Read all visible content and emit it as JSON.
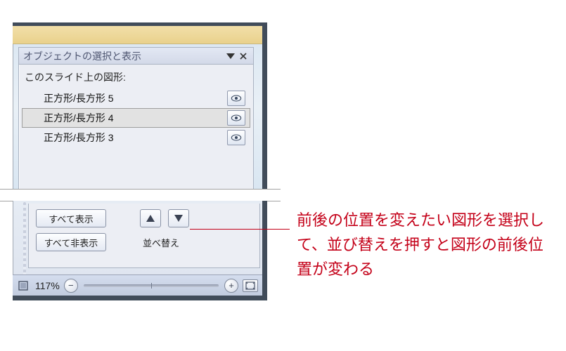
{
  "pane": {
    "title": "オブジェクトの選択と表示",
    "sub_label": "このスライド上の図形:"
  },
  "shapes": [
    {
      "label": "正方形/長方形 5",
      "selected": false
    },
    {
      "label": "正方形/長方形 4",
      "selected": true
    },
    {
      "label": "正方形/長方形 3",
      "selected": false
    }
  ],
  "controls": {
    "show_all": "すべて表示",
    "hide_all": "すべて非表示",
    "reorder_label": "並べ替え"
  },
  "status": {
    "zoom_text": "117%"
  },
  "callout": {
    "text": "前後の位置を変えたい図形を選択して、並び替えを押すと図形の前後位置が変わる"
  }
}
